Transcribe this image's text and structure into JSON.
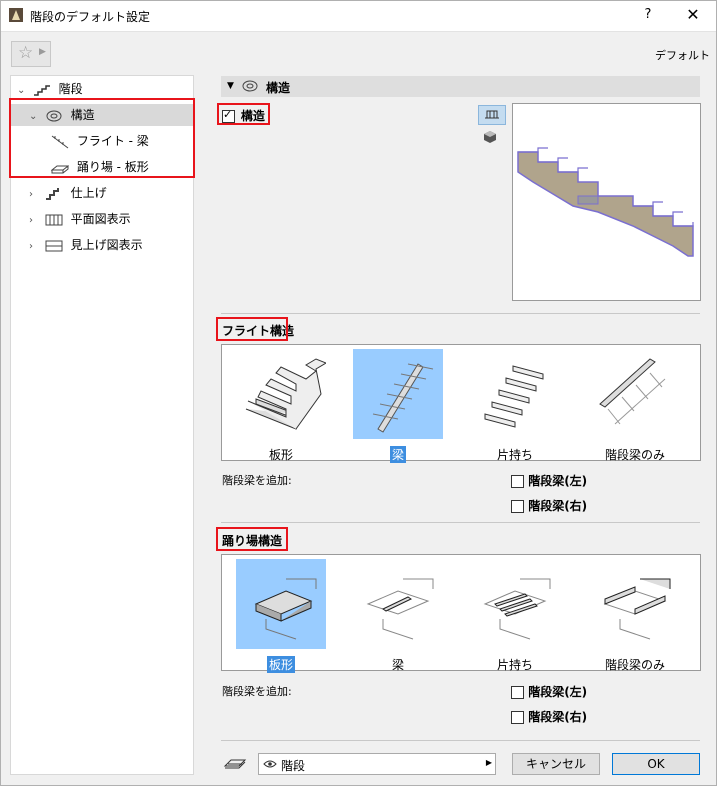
{
  "window": {
    "title": "階段のデフォルト設定",
    "help": "?",
    "close": "✕"
  },
  "toolbar": {
    "favorites_icon": "star-icon",
    "default_label": "デフォルト"
  },
  "tree": {
    "root": "階段",
    "structure": "構造",
    "flight_beam": "フライト - 梁",
    "landing_slab": "踊り場 - 板形",
    "finish": "仕上げ",
    "floor_plan": "平面図表示",
    "ceiling_plan": "見上げ図表示"
  },
  "section": {
    "title": "構造",
    "checkbox_label": "構造",
    "checked": true
  },
  "flight": {
    "title": "フライト構造",
    "options": [
      "板形",
      "梁",
      "片持ち",
      "階段梁のみ"
    ],
    "selected": "梁",
    "add_stringer_label": "階段梁を追加:",
    "left_label": "階段梁(左)",
    "right_label": "階段梁(右)"
  },
  "landing": {
    "title": "踊り場構造",
    "options": [
      "板形",
      "梁",
      "片持ち",
      "階段梁のみ"
    ],
    "selected": "板形",
    "add_stringer_label": "階段梁を追加:",
    "left_label": "階段梁(左)",
    "right_label": "階段梁(右)"
  },
  "footer": {
    "layer": "階段",
    "cancel": "キャンセル",
    "ok": "OK"
  },
  "colors": {
    "highlight_red": "#e8141b",
    "selection_blue": "#99ccff",
    "stair_fill": "#b0a48c",
    "stair_edge": "#7a6fd0"
  }
}
